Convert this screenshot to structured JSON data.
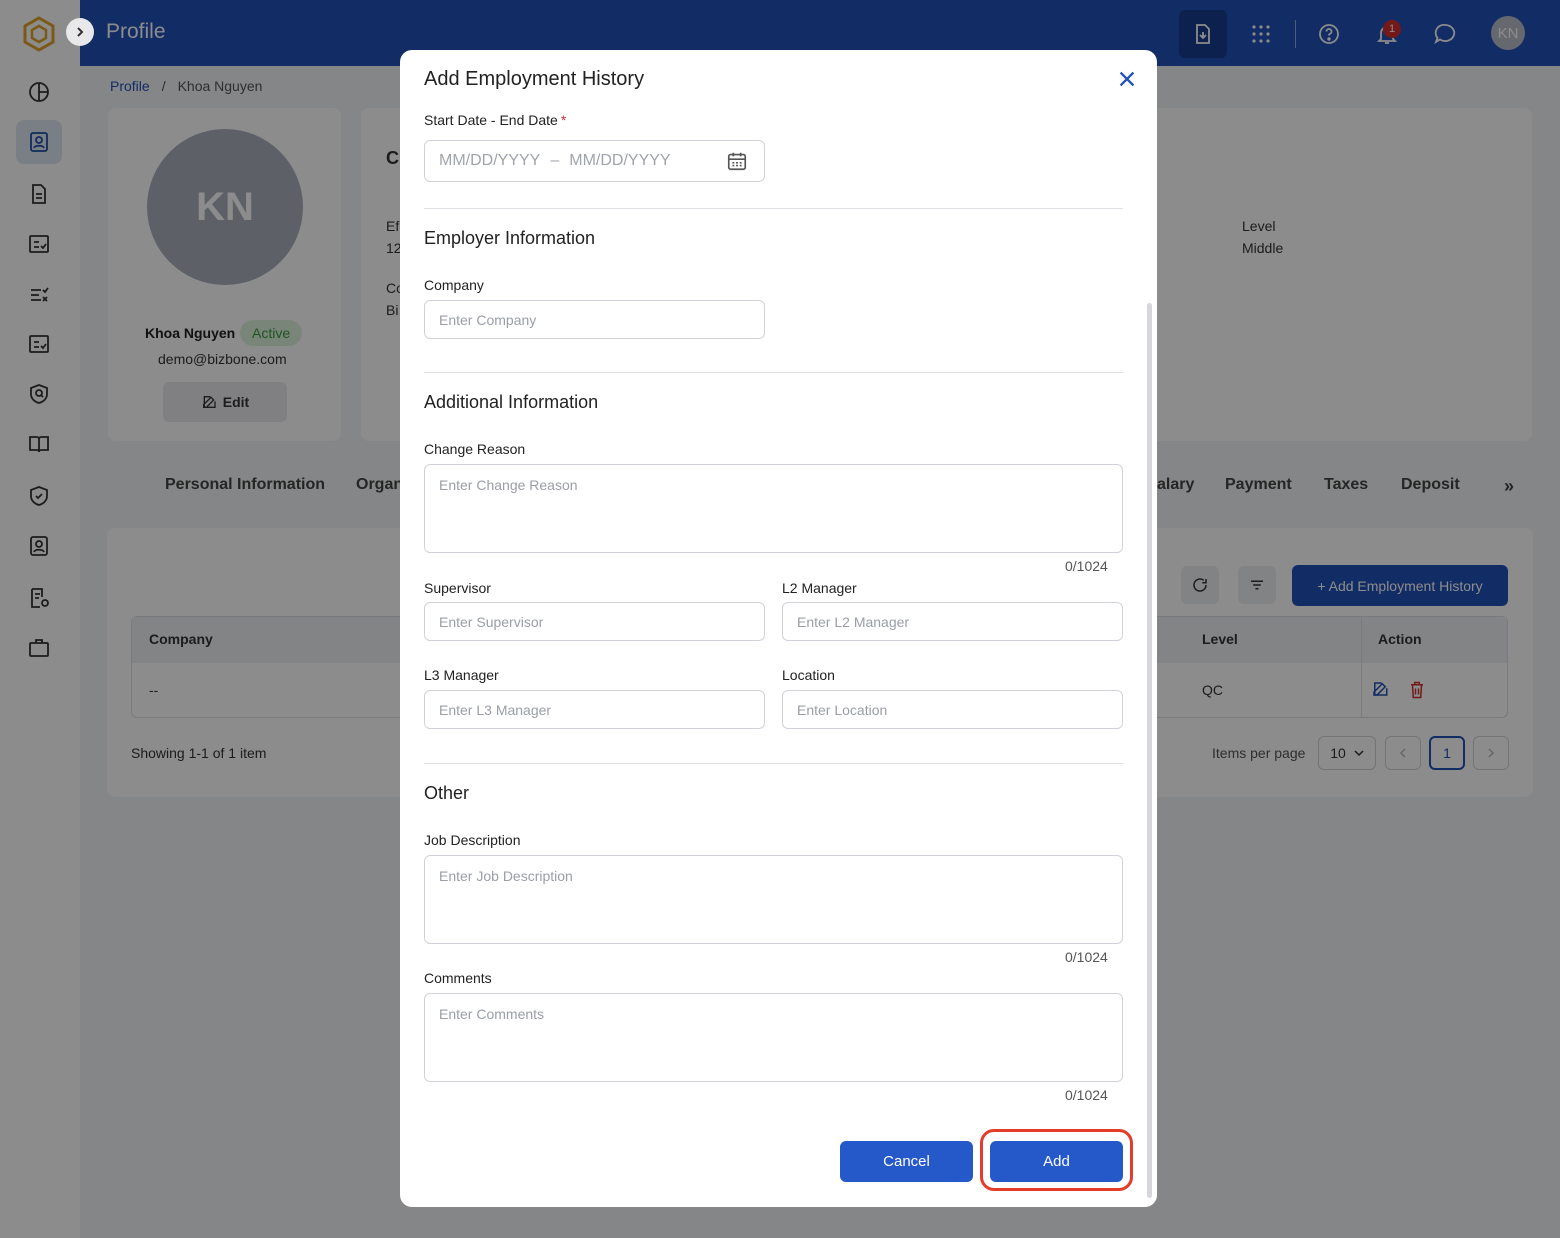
{
  "header": {
    "title": "Profile",
    "notification_count": "1",
    "avatar_initials": "KN"
  },
  "breadcrumb": {
    "root": "Profile",
    "sep": "/",
    "current": "Khoa Nguyen"
  },
  "profile": {
    "initials": "KN",
    "name": "Khoa Nguyen",
    "status": "Active",
    "email": "demo@bizbone.com",
    "edit_label": "Edit"
  },
  "background": {
    "card_partial_title": "C",
    "eff_label": "Ef",
    "eff_value": "12",
    "co_label": "Co",
    "co_value": "Bi",
    "level_label": "Level",
    "level_value": "Middle"
  },
  "tabs": [
    "Personal Information",
    "Organ",
    "alary",
    "Payment",
    "Taxes",
    "Deposit"
  ],
  "table": {
    "add_button": "+ Add Employment History",
    "headers": {
      "company": "Company",
      "level": "Level",
      "action": "Action"
    },
    "row": {
      "company": "--",
      "level": "QC"
    },
    "showing": "Showing 1-1 of 1 item",
    "items_per_page_label": "Items per page",
    "items_per_page": "10",
    "current_page": "1"
  },
  "modal": {
    "title": "Add Employment History",
    "date_label": "Start Date - End Date",
    "date_start_placeholder": "MM/DD/YYYY",
    "date_sep": "–",
    "date_end_placeholder": "MM/DD/YYYY",
    "employer_section": "Employer Information",
    "company_label": "Company",
    "company_placeholder": "Enter Company",
    "additional_section": "Additional Information",
    "change_reason_label": "Change Reason",
    "change_reason_placeholder": "Enter Change Reason",
    "change_reason_counter": "0/1024",
    "supervisor_label": "Supervisor",
    "supervisor_placeholder": "Enter Supervisor",
    "l2_label": "L2 Manager",
    "l2_placeholder": "Enter L2 Manager",
    "l3_label": "L3 Manager",
    "l3_placeholder": "Enter L3 Manager",
    "location_label": "Location",
    "location_placeholder": "Enter Location",
    "other_section": "Other",
    "job_desc_label": "Job Description",
    "job_desc_placeholder": "Enter Job Description",
    "job_desc_counter": "0/1024",
    "comments_label": "Comments",
    "comments_placeholder": "Enter Comments",
    "comments_counter": "0/1024",
    "cancel_label": "Cancel",
    "add_label": "Add"
  },
  "colors": {
    "primary": "#2150b8",
    "button": "#2558c9",
    "highlight": "#e43b2a",
    "active_green": "#3a9b3a"
  }
}
